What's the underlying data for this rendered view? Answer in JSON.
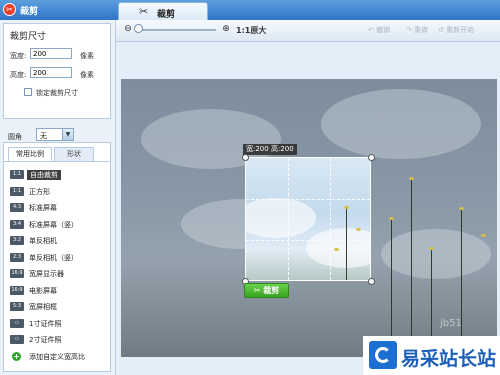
{
  "window": {
    "title": "裁剪",
    "tab_label": "裁剪"
  },
  "crop_size": {
    "title": "裁剪尺寸",
    "width_label": "宽度:",
    "width_value": "200",
    "height_label": "高度:",
    "height_value": "200",
    "unit": "像素",
    "lock_label": "锁定裁剪尺寸",
    "lock_checked": false
  },
  "corner": {
    "label": "圆角",
    "value": "无"
  },
  "ratio_panel": {
    "tabs": [
      "常用比例",
      "形状"
    ],
    "items": [
      {
        "icon": "1:1",
        "label": "自由裁剪",
        "selected": true
      },
      {
        "icon": "1:1",
        "label": "正方形"
      },
      {
        "icon": "4:3",
        "label": "标准屏幕"
      },
      {
        "icon": "3:4",
        "label": "标准屏幕（竖）"
      },
      {
        "icon": "3:2",
        "label": "单反相机"
      },
      {
        "icon": "2:3",
        "label": "单反相机（竖）"
      },
      {
        "icon": "16:9",
        "label": "宽屏显示器"
      },
      {
        "icon": "16:9",
        "label": "电影屏幕"
      },
      {
        "icon": "5:3",
        "label": "宽屏相框"
      },
      {
        "icon": "id",
        "label": "1寸证件照"
      },
      {
        "icon": "id",
        "label": "2寸证件照"
      },
      {
        "icon": "plus",
        "label": "添加自定义宽高比"
      }
    ]
  },
  "toolbar": {
    "zoom_value": 0,
    "actual_size_label": "1:1原大",
    "undo_label": "撤销",
    "redo_label": "重做",
    "restart_label": "重新开始"
  },
  "canvas": {
    "dimension_label": "宽:200 高:200",
    "crop_button_label": "裁剪"
  },
  "watermark": {
    "text": "易采站长站",
    "faint": "jb51"
  },
  "colors": {
    "accent": "#2f74c6",
    "crop_button": "#4bb82b"
  }
}
